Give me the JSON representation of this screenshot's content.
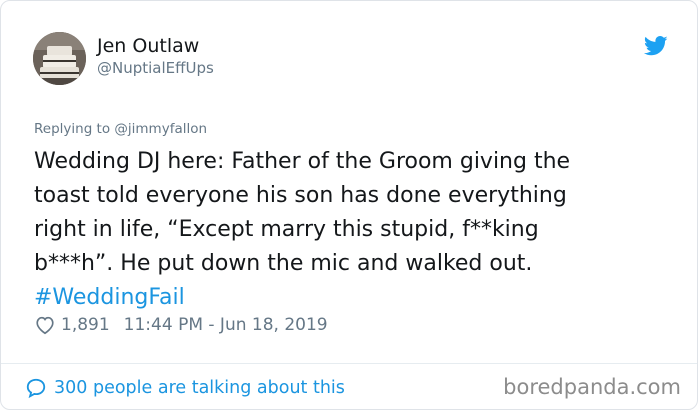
{
  "author": {
    "name": "Jen Outlaw",
    "handle": "@NuptialEffUps",
    "avatar": "wedding-cake-photo"
  },
  "reply": {
    "text": "Replying to @jimmyfallon"
  },
  "tweet": {
    "lines": [
      "Wedding DJ here: Father of the Groom giving the",
      "toast told everyone his son has done everything",
      "right in life, “Except marry this stupid, f**king",
      "b***h”. He put down the mic and walked out."
    ],
    "hashtag": "#WeddingFail"
  },
  "meta": {
    "likes": "1,891",
    "timestamp": "11:44 PM - Jun 18, 2019"
  },
  "footer": {
    "talking": "300 people are talking about this",
    "watermark": "boredpanda.com"
  },
  "colors": {
    "accent": "#1b95e0",
    "muted": "#657786",
    "text": "#14171a"
  },
  "icons": [
    "twitter-bird-icon",
    "heart-icon",
    "comment-bubble-icon"
  ]
}
